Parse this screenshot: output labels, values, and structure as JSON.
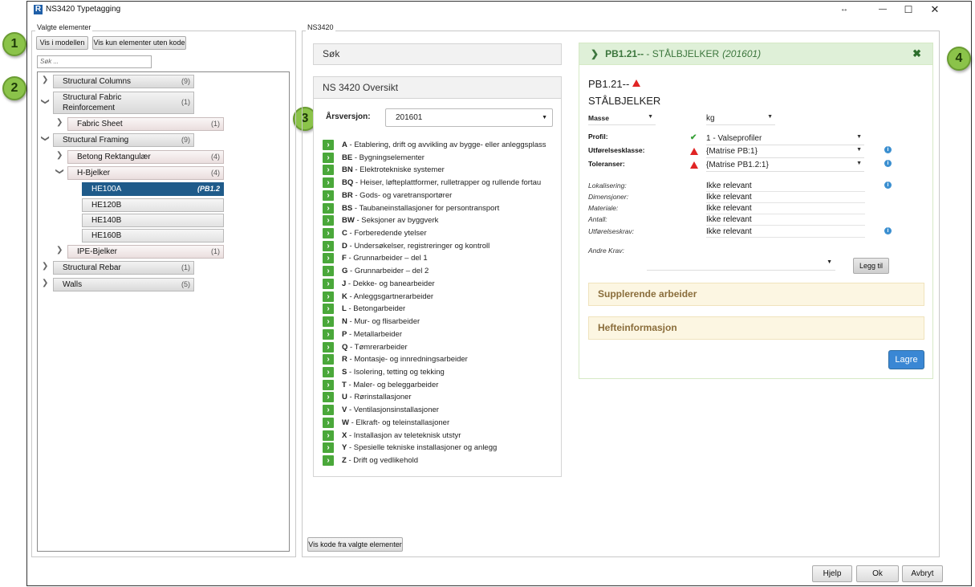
{
  "window": {
    "title": "NS3420 Typetagging",
    "logo": "R",
    "controls": {
      "resize": "↔",
      "minimize": "—",
      "maximize": "☐",
      "close": "✕"
    }
  },
  "callouts": [
    "1",
    "2",
    "3",
    "4"
  ],
  "left": {
    "group_label": "Valgte elementer",
    "btn_show_model": "Vis i modellen",
    "btn_show_uncoded": "Vis kun elementer uten kode",
    "search_placeholder": "Søk ...",
    "tree": [
      {
        "label": "Structural Columns",
        "count": "(9)"
      },
      {
        "label": "Structural Fabric Reinforcement",
        "count": "(1)"
      },
      {
        "label": "Fabric Sheet",
        "count": "(1)"
      },
      {
        "label": "Structural Framing",
        "count": "(9)"
      },
      {
        "label": "Betong Rektangulær",
        "count": "(4)"
      },
      {
        "label": "H-Bjelker",
        "count": "(4)"
      },
      {
        "label": "HE100A",
        "count": "(PB1.2"
      },
      {
        "label": "HE120B",
        "count": ""
      },
      {
        "label": "HE140B",
        "count": ""
      },
      {
        "label": "HE160B",
        "count": ""
      },
      {
        "label": "IPE-Bjelker",
        "count": "(1)"
      },
      {
        "label": "Structural Rebar",
        "count": "(1)"
      },
      {
        "label": "Walls",
        "count": "(5)"
      }
    ],
    "btn_show_code": "Vis kode fra valgte elementer"
  },
  "middle": {
    "group_label": "NS3420",
    "search_header": "Søk",
    "overview_header": "NS 3420 Oversikt",
    "year_label": "Årsversjon:",
    "year_value": "201601",
    "categories": [
      {
        "code": "A",
        "name": " - Etablering, drift og avvikling av bygge- eller anleggsplass"
      },
      {
        "code": "BE",
        "name": " - Bygningselementer"
      },
      {
        "code": "BN",
        "name": " - Elektrotekniske systemer"
      },
      {
        "code": "BQ",
        "name": " - Heiser, løfteplattformer, rulletrapper og rullende fortau"
      },
      {
        "code": "BR",
        "name": " - Gods- og varetransportører"
      },
      {
        "code": "BS",
        "name": " - Taubaneinstallasjoner for persontransport"
      },
      {
        "code": "BW",
        "name": " - Seksjoner av byggverk"
      },
      {
        "code": "C",
        "name": " - Forberedende ytelser"
      },
      {
        "code": "D",
        "name": " - Undersøkelser, registreringer og kontroll"
      },
      {
        "code": "F",
        "name": " - Grunnarbeider – del 1"
      },
      {
        "code": "G",
        "name": " - Grunnarbeider – del 2"
      },
      {
        "code": "J",
        "name": " - Dekke- og banearbeider"
      },
      {
        "code": "K",
        "name": " - Anleggsgartnerarbeider"
      },
      {
        "code": "L",
        "name": " - Betongarbeider"
      },
      {
        "code": "N",
        "name": " - Mur- og flisarbeider"
      },
      {
        "code": "P",
        "name": " - Metallarbeider"
      },
      {
        "code": "Q",
        "name": " - Tømrerarbeider"
      },
      {
        "code": "R",
        "name": " - Montasje- og innredningsarbeider"
      },
      {
        "code": "S",
        "name": " - Isolering, tetting og tekking"
      },
      {
        "code": "T",
        "name": " - Maler- og beleggarbeider"
      },
      {
        "code": "U",
        "name": " - Rørinstallasjoner"
      },
      {
        "code": "V",
        "name": " - Ventilasjonsinstallasjoner"
      },
      {
        "code": "W",
        "name": " - Elkraft- og teleinstallasjoner"
      },
      {
        "code": "X",
        "name": " - Installasjon av teleteknisk utstyr"
      },
      {
        "code": "Y",
        "name": " - Spesielle tekniske installasjoner og anlegg"
      },
      {
        "code": "Z",
        "name": " - Drift og vedlikehold"
      }
    ]
  },
  "detail": {
    "header_code": "PB1.21--",
    "header_sep": " - ",
    "header_name": "STÅLBJELKER",
    "header_year": "(201601)",
    "code": "PB1.21--",
    "name": "STÅLBJELKER",
    "unit_type": "Masse",
    "unit": "kg",
    "props": [
      {
        "label": "Profil:",
        "value": "1 - Valseprofiler",
        "status": "ok"
      },
      {
        "label": "Utførelsesklasse:",
        "value": "{Matrise PB:1}",
        "status": "warn"
      },
      {
        "label": "Toleranser:",
        "value": "{Matrise PB1.2:1}",
        "status": "warn"
      }
    ],
    "fields": [
      {
        "label": "Lokalisering:",
        "value": "Ikke relevant"
      },
      {
        "label": "Dimensjoner:",
        "value": "Ikke relevant"
      },
      {
        "label": "Materiale:",
        "value": "Ikke relevant"
      },
      {
        "label": "Antall:",
        "value": "Ikke relevant"
      },
      {
        "label": "Utførelseskrav:",
        "value": "Ikke relevant"
      }
    ],
    "other_req_label": "Andre Krav:",
    "add_button": "Legg til",
    "section_supplementary": "Supplerende arbeider",
    "section_booklet": "Hefteinformasjon",
    "save_button": "Lagre"
  },
  "footer": {
    "help": "Hjelp",
    "ok": "Ok",
    "cancel": "Avbryt"
  },
  "colors": {
    "accent": "#1f5b8a",
    "green": "#4aa83a",
    "warning": "#e02424",
    "info": "#3b8fd0",
    "save": "#3a87d4",
    "header_bg": "#dff0d8"
  }
}
